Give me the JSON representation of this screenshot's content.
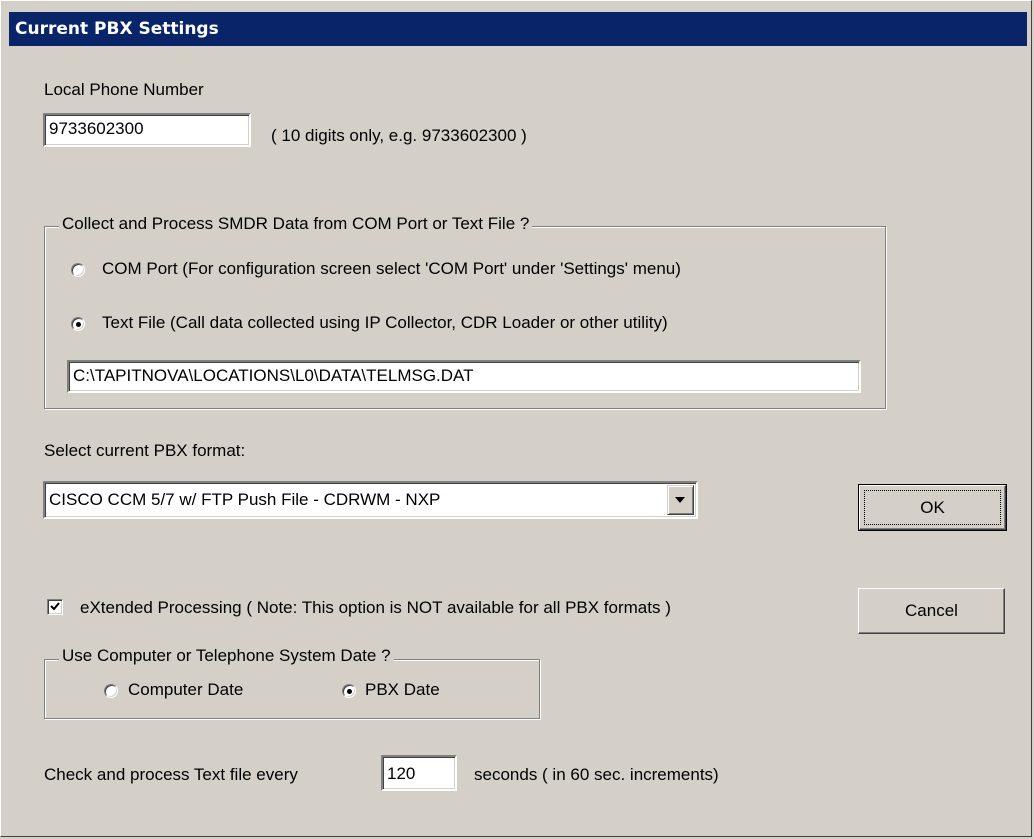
{
  "dialog": {
    "title": "Current PBX Settings"
  },
  "local_phone": {
    "label": "Local Phone Number",
    "value": "9733602300",
    "hint": "( 10 digits only, e.g. 9733602300 )"
  },
  "smdr_source": {
    "legend": "Collect and Process SMDR Data from COM Port or Text File ?",
    "options": [
      {
        "label": "COM Port (For configuration screen select 'COM Port' under 'Settings' menu)",
        "selected": false
      },
      {
        "label": "Text File (Call data collected using IP Collector, CDR Loader or other utility)",
        "selected": true
      }
    ],
    "file_path": "C:\\TAPITNOVA\\LOCATIONS\\L0\\DATA\\TELMSG.DAT"
  },
  "pbx_format": {
    "label": "Select current PBX format:",
    "selected": "CISCO CCM 5/7 w/ FTP Push File - CDRWM - NXP"
  },
  "extended_processing": {
    "label": "eXtended Processing ( Note: This option is NOT available for all PBX formats )",
    "checked": true
  },
  "date_source": {
    "legend": "Use Computer or Telephone System Date ?",
    "options": [
      {
        "label": "Computer Date",
        "selected": false
      },
      {
        "label": "PBX Date",
        "selected": true
      }
    ]
  },
  "interval": {
    "prefix": "Check and process Text file every",
    "value": "120",
    "suffix": "seconds ( in 60 sec. increments)"
  },
  "buttons": {
    "ok": "OK",
    "cancel": "Cancel"
  },
  "colors": {
    "titlebar": "#0a246a",
    "face": "#d4d0c8"
  }
}
